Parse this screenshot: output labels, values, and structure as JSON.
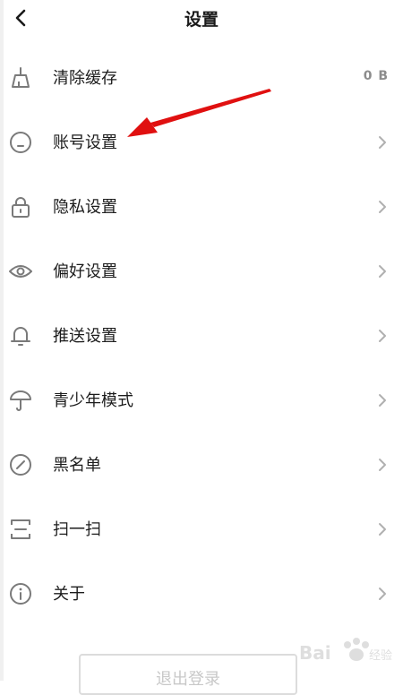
{
  "header": {
    "title": "设置"
  },
  "settings": {
    "items": [
      {
        "label": "清除缓存",
        "icon": "broom-icon",
        "value": "0 B"
      },
      {
        "label": "账号设置",
        "icon": "account-icon"
      },
      {
        "label": "隐私设置",
        "icon": "lock-icon"
      },
      {
        "label": "偏好设置",
        "icon": "eye-icon"
      },
      {
        "label": "推送设置",
        "icon": "bell-icon"
      },
      {
        "label": "青少年模式",
        "icon": "umbrella-icon"
      },
      {
        "label": "黑名单",
        "icon": "block-icon"
      },
      {
        "label": "扫一扫",
        "icon": "scan-icon"
      },
      {
        "label": "关于",
        "icon": "info-icon"
      }
    ]
  },
  "footer": {
    "logout_label": "退出登录"
  },
  "watermark": {
    "text": "Bai 经验"
  },
  "colors": {
    "annotation_arrow": "#e01010",
    "icon_gray": "#7a7a7a",
    "chevron_gray": "#b0b0b0"
  }
}
